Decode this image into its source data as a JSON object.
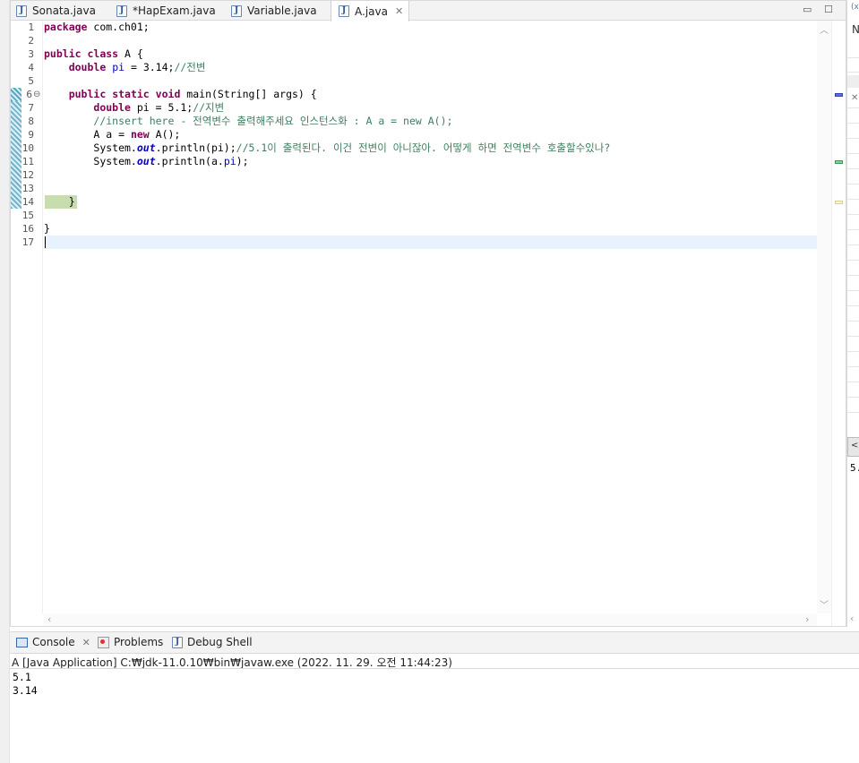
{
  "editor": {
    "tabs": [
      {
        "label": "Sonata.java",
        "active": false
      },
      {
        "label": "*HapExam.java",
        "active": false
      },
      {
        "label": "Variable.java",
        "active": false
      },
      {
        "label": "A.java",
        "active": true,
        "close": "✕"
      }
    ],
    "window_buttons": {
      "minimize": "▭",
      "maximize": "☐"
    },
    "line_numbers": [
      "1",
      "2",
      "3",
      "4",
      "5",
      "6",
      "7",
      "8",
      "9",
      "10",
      "11",
      "12",
      "13",
      "14",
      "15",
      "16",
      "17"
    ],
    "fold_marker": "⊖",
    "code": {
      "l1_kw": "package",
      "l1_rest": " com.ch01;",
      "l3_kw1": "public",
      "l3_kw2": "class",
      "l3_rest": " A {",
      "l4_kw": "double",
      "l4_field": "pi",
      "l4_rest": " = 3.14;",
      "l4_cm": "//전변",
      "l6_kw1": "public",
      "l6_kw2": "static",
      "l6_kw3": "void",
      "l6_rest": " main(String[] args) {",
      "l7_kw": "double",
      "l7_rest": " pi = 5.1;",
      "l7_cm": "//지변",
      "l8_cm": "//insert here - 전역변수 출력해주세요 인스턴스화 : A a = new A();",
      "l9_pre": "A a = ",
      "l9_kw": "new",
      "l9_rest": " A();",
      "l10_pre": "System.",
      "l10_static": "out",
      "l10_rest": ".println(pi);",
      "l10_cm": "//5.1이 출력된다. 이건 전변이 아니잖아. 어떻게 하면 전역변수 호출할수있나?",
      "l11_pre": "System.",
      "l11_static": "out",
      "l11_mid": ".println(a.",
      "l11_field": "pi",
      "l11_rest": ");",
      "l14": "}",
      "l16": "}"
    }
  },
  "console": {
    "tabs": [
      {
        "label": "Console",
        "close": "✕"
      },
      {
        "label": "Problems"
      },
      {
        "label": "Debug Shell"
      }
    ],
    "description": "A [Java Application] C:₩jdk-11.0.10₩bin₩javaw.exe  (2022. 11. 29. 오전 11:44:23)",
    "output": [
      "5.1",
      "3.14"
    ]
  },
  "side_view": {
    "header": "(x",
    "item": "N",
    "output": "5."
  }
}
